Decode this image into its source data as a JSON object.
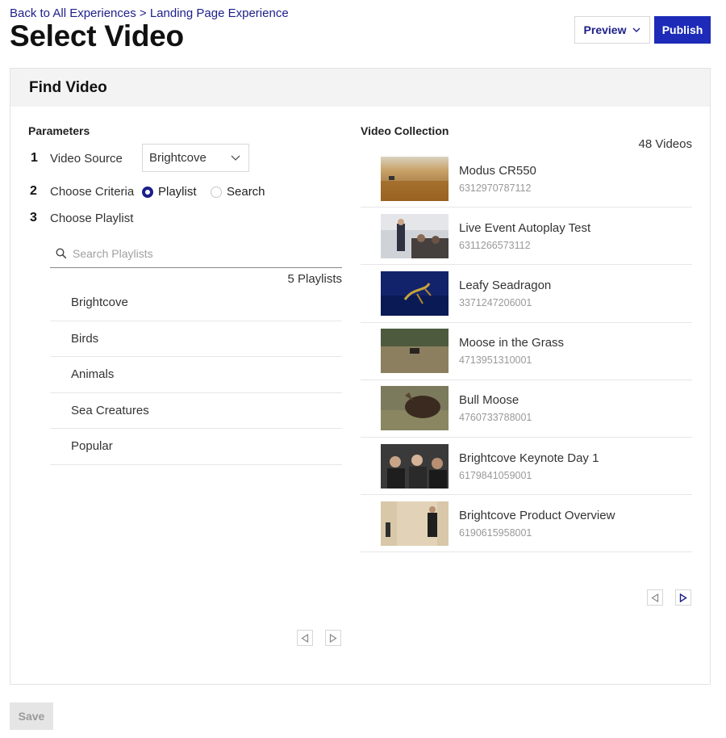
{
  "breadcrumb": {
    "back_link": "Back to All Experiences",
    "separator": ">",
    "current": "Landing Page Experience"
  },
  "page_title": "Select Video",
  "header_actions": {
    "preview_label": "Preview",
    "publish_label": "Publish"
  },
  "panel": {
    "title": "Find Video"
  },
  "parameters": {
    "heading": "Parameters",
    "steps": [
      {
        "number": "1",
        "label": "Video Source"
      },
      {
        "number": "2",
        "label": "Choose Criteria"
      },
      {
        "number": "3",
        "label": "Choose Playlist"
      }
    ],
    "video_source_value": "Brightcove",
    "criteria_options": [
      {
        "label": "Playlist",
        "checked": true
      },
      {
        "label": "Search",
        "checked": false
      }
    ],
    "search_placeholder": "Search Playlists",
    "playlist_count": "5 Playlists",
    "playlists": [
      "Brightcove",
      "Birds",
      "Animals",
      "Sea Creatures",
      "Popular"
    ]
  },
  "collection": {
    "heading": "Video Collection",
    "count": "48 Videos",
    "videos": [
      {
        "title": "Modus CR550",
        "id": "6312970787112"
      },
      {
        "title": "Live Event Autoplay Test",
        "id": "6311266573112"
      },
      {
        "title": "Leafy Seadragon",
        "id": "3371247206001"
      },
      {
        "title": "Moose in the Grass",
        "id": "4713951310001"
      },
      {
        "title": "Bull Moose",
        "id": "4760733788001"
      },
      {
        "title": "Brightcove Keynote Day 1",
        "id": "6179841059001"
      },
      {
        "title": "Brightcove Product Overview",
        "id": "6190615958001"
      }
    ]
  },
  "footer": {
    "save_label": "Save"
  },
  "colors": {
    "accent": "#1d2bb8",
    "link": "#1d1f8a",
    "disabled": "#e5e5e5"
  }
}
